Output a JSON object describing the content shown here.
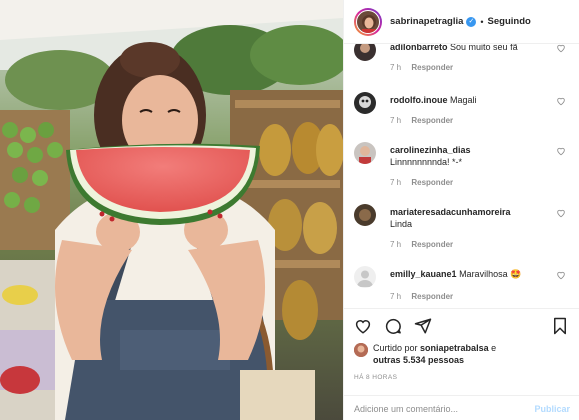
{
  "post": {
    "username": "sabrinapetraglia",
    "follow_state": "Seguindo",
    "separator": "•"
  },
  "comments": [
    {
      "username": "adilonbarreto",
      "text": "Sou muito seu fã",
      "time": "7 h",
      "reply": "Responder"
    },
    {
      "username": "rodolfo.inoue",
      "text": "Magali",
      "time": "7 h",
      "reply": "Responder"
    },
    {
      "username": "carolinezinha_dias",
      "text": "Linnnnnnnnda! *-*",
      "time": "7 h",
      "reply": "Responder"
    },
    {
      "username": "mariateresadacunhamoreira",
      "text": "Linda",
      "time": "7 h",
      "reply": "Responder"
    },
    {
      "username": "emilly_kauane1",
      "text": "Maravilhosa 🤩",
      "time": "7 h",
      "reply": "Responder"
    }
  ],
  "likes": {
    "prefix": "Curtido por",
    "user": "soniapetrabalsa",
    "conjunction": "e",
    "others": "outras 5.534 pessoas"
  },
  "timestamp": "HÁ 8 HORAS",
  "comment_box": {
    "placeholder": "Adicione um comentário...",
    "publish_label": "Publicar"
  },
  "icons": {
    "like": "heart-icon",
    "comment": "comment-icon",
    "share": "share-icon",
    "save": "bookmark-icon"
  },
  "colors": {
    "verified": "#3897f0",
    "publish_disabled": "#b3dbff",
    "meta_text": "#8e8e8e"
  }
}
